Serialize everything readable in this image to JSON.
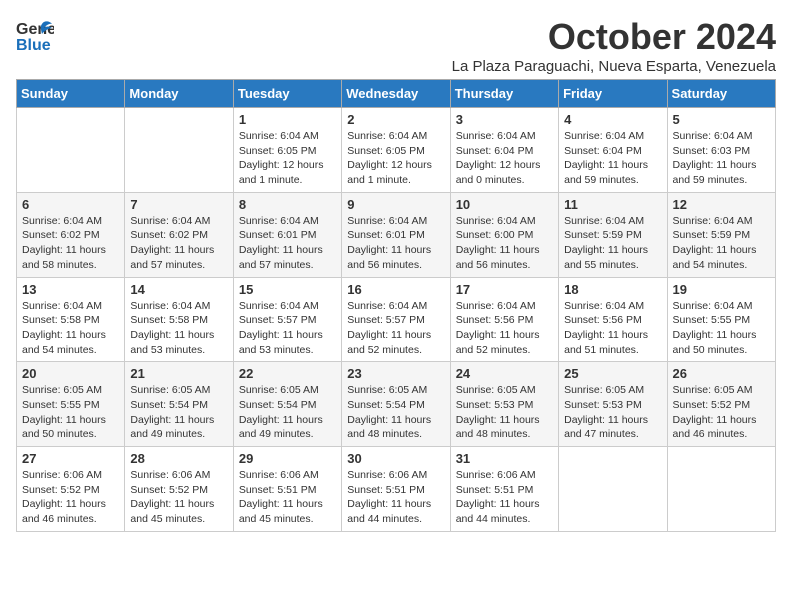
{
  "header": {
    "logo_general": "General",
    "logo_blue": "Blue",
    "month": "October 2024",
    "location": "La Plaza Paraguachi, Nueva Esparta, Venezuela"
  },
  "days_of_week": [
    "Sunday",
    "Monday",
    "Tuesday",
    "Wednesday",
    "Thursday",
    "Friday",
    "Saturday"
  ],
  "weeks": [
    [
      {
        "day": "",
        "content": ""
      },
      {
        "day": "",
        "content": ""
      },
      {
        "day": "1",
        "sunrise": "Sunrise: 6:04 AM",
        "sunset": "Sunset: 6:05 PM",
        "daylight": "Daylight: 12 hours and 1 minute."
      },
      {
        "day": "2",
        "sunrise": "Sunrise: 6:04 AM",
        "sunset": "Sunset: 6:05 PM",
        "daylight": "Daylight: 12 hours and 1 minute."
      },
      {
        "day": "3",
        "sunrise": "Sunrise: 6:04 AM",
        "sunset": "Sunset: 6:04 PM",
        "daylight": "Daylight: 12 hours and 0 minutes."
      },
      {
        "day": "4",
        "sunrise": "Sunrise: 6:04 AM",
        "sunset": "Sunset: 6:04 PM",
        "daylight": "Daylight: 11 hours and 59 minutes."
      },
      {
        "day": "5",
        "sunrise": "Sunrise: 6:04 AM",
        "sunset": "Sunset: 6:03 PM",
        "daylight": "Daylight: 11 hours and 59 minutes."
      }
    ],
    [
      {
        "day": "6",
        "sunrise": "Sunrise: 6:04 AM",
        "sunset": "Sunset: 6:02 PM",
        "daylight": "Daylight: 11 hours and 58 minutes."
      },
      {
        "day": "7",
        "sunrise": "Sunrise: 6:04 AM",
        "sunset": "Sunset: 6:02 PM",
        "daylight": "Daylight: 11 hours and 57 minutes."
      },
      {
        "day": "8",
        "sunrise": "Sunrise: 6:04 AM",
        "sunset": "Sunset: 6:01 PM",
        "daylight": "Daylight: 11 hours and 57 minutes."
      },
      {
        "day": "9",
        "sunrise": "Sunrise: 6:04 AM",
        "sunset": "Sunset: 6:01 PM",
        "daylight": "Daylight: 11 hours and 56 minutes."
      },
      {
        "day": "10",
        "sunrise": "Sunrise: 6:04 AM",
        "sunset": "Sunset: 6:00 PM",
        "daylight": "Daylight: 11 hours and 56 minutes."
      },
      {
        "day": "11",
        "sunrise": "Sunrise: 6:04 AM",
        "sunset": "Sunset: 5:59 PM",
        "daylight": "Daylight: 11 hours and 55 minutes."
      },
      {
        "day": "12",
        "sunrise": "Sunrise: 6:04 AM",
        "sunset": "Sunset: 5:59 PM",
        "daylight": "Daylight: 11 hours and 54 minutes."
      }
    ],
    [
      {
        "day": "13",
        "sunrise": "Sunrise: 6:04 AM",
        "sunset": "Sunset: 5:58 PM",
        "daylight": "Daylight: 11 hours and 54 minutes."
      },
      {
        "day": "14",
        "sunrise": "Sunrise: 6:04 AM",
        "sunset": "Sunset: 5:58 PM",
        "daylight": "Daylight: 11 hours and 53 minutes."
      },
      {
        "day": "15",
        "sunrise": "Sunrise: 6:04 AM",
        "sunset": "Sunset: 5:57 PM",
        "daylight": "Daylight: 11 hours and 53 minutes."
      },
      {
        "day": "16",
        "sunrise": "Sunrise: 6:04 AM",
        "sunset": "Sunset: 5:57 PM",
        "daylight": "Daylight: 11 hours and 52 minutes."
      },
      {
        "day": "17",
        "sunrise": "Sunrise: 6:04 AM",
        "sunset": "Sunset: 5:56 PM",
        "daylight": "Daylight: 11 hours and 52 minutes."
      },
      {
        "day": "18",
        "sunrise": "Sunrise: 6:04 AM",
        "sunset": "Sunset: 5:56 PM",
        "daylight": "Daylight: 11 hours and 51 minutes."
      },
      {
        "day": "19",
        "sunrise": "Sunrise: 6:04 AM",
        "sunset": "Sunset: 5:55 PM",
        "daylight": "Daylight: 11 hours and 50 minutes."
      }
    ],
    [
      {
        "day": "20",
        "sunrise": "Sunrise: 6:05 AM",
        "sunset": "Sunset: 5:55 PM",
        "daylight": "Daylight: 11 hours and 50 minutes."
      },
      {
        "day": "21",
        "sunrise": "Sunrise: 6:05 AM",
        "sunset": "Sunset: 5:54 PM",
        "daylight": "Daylight: 11 hours and 49 minutes."
      },
      {
        "day": "22",
        "sunrise": "Sunrise: 6:05 AM",
        "sunset": "Sunset: 5:54 PM",
        "daylight": "Daylight: 11 hours and 49 minutes."
      },
      {
        "day": "23",
        "sunrise": "Sunrise: 6:05 AM",
        "sunset": "Sunset: 5:54 PM",
        "daylight": "Daylight: 11 hours and 48 minutes."
      },
      {
        "day": "24",
        "sunrise": "Sunrise: 6:05 AM",
        "sunset": "Sunset: 5:53 PM",
        "daylight": "Daylight: 11 hours and 48 minutes."
      },
      {
        "day": "25",
        "sunrise": "Sunrise: 6:05 AM",
        "sunset": "Sunset: 5:53 PM",
        "daylight": "Daylight: 11 hours and 47 minutes."
      },
      {
        "day": "26",
        "sunrise": "Sunrise: 6:05 AM",
        "sunset": "Sunset: 5:52 PM",
        "daylight": "Daylight: 11 hours and 46 minutes."
      }
    ],
    [
      {
        "day": "27",
        "sunrise": "Sunrise: 6:06 AM",
        "sunset": "Sunset: 5:52 PM",
        "daylight": "Daylight: 11 hours and 46 minutes."
      },
      {
        "day": "28",
        "sunrise": "Sunrise: 6:06 AM",
        "sunset": "Sunset: 5:52 PM",
        "daylight": "Daylight: 11 hours and 45 minutes."
      },
      {
        "day": "29",
        "sunrise": "Sunrise: 6:06 AM",
        "sunset": "Sunset: 5:51 PM",
        "daylight": "Daylight: 11 hours and 45 minutes."
      },
      {
        "day": "30",
        "sunrise": "Sunrise: 6:06 AM",
        "sunset": "Sunset: 5:51 PM",
        "daylight": "Daylight: 11 hours and 44 minutes."
      },
      {
        "day": "31",
        "sunrise": "Sunrise: 6:06 AM",
        "sunset": "Sunset: 5:51 PM",
        "daylight": "Daylight: 11 hours and 44 minutes."
      },
      {
        "day": "",
        "content": ""
      },
      {
        "day": "",
        "content": ""
      }
    ]
  ]
}
